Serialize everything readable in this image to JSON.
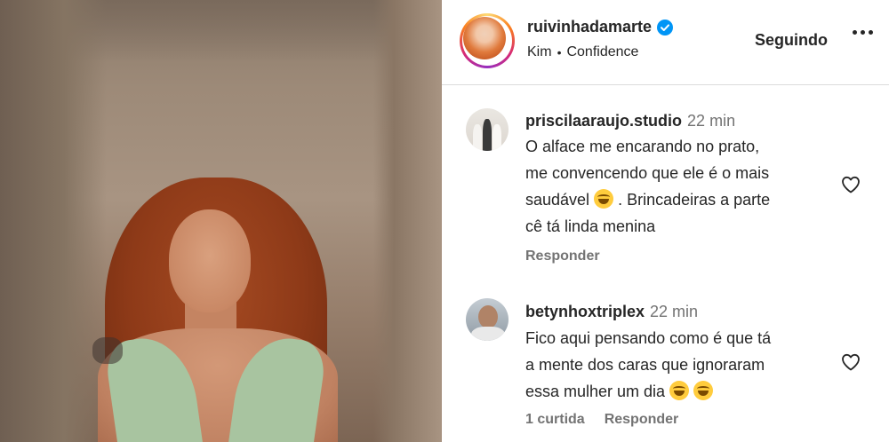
{
  "post": {
    "author": {
      "username": "ruivinhadamarte",
      "verified": true,
      "subtitle_artist": "Kim",
      "subtitle_separator": "•",
      "subtitle_track": "Confidence"
    },
    "follow_label": "Seguindo",
    "more_icon": "more-horizontal-icon"
  },
  "comments": [
    {
      "username": "priscilaaraujo.studio",
      "time": "22 min",
      "lines": [
        "O alface me encarando no prato,",
        "me convencendo que ele é o mais",
        "saudável",
        ". Brincadeiras a parte",
        "cê tá linda menina"
      ],
      "emoji": "grinning-sweat-emoji",
      "reply_label": "Responder",
      "like_icon": "heart-outline-icon"
    },
    {
      "username": "betynhoxtriplex",
      "time": "22 min",
      "lines": [
        "Fico aqui pensando como é que tá",
        "a mente dos caras que ignoraram",
        "essa mulher um dia"
      ],
      "emoji": "tears-of-joy-emoji",
      "likes_label": "1 curtida",
      "reply_label": "Responder",
      "like_icon": "heart-outline-icon"
    }
  ],
  "colors": {
    "verified": "#0095f6",
    "text_primary": "#262626",
    "text_secondary": "#737373",
    "divider": "#dbdbdb"
  }
}
